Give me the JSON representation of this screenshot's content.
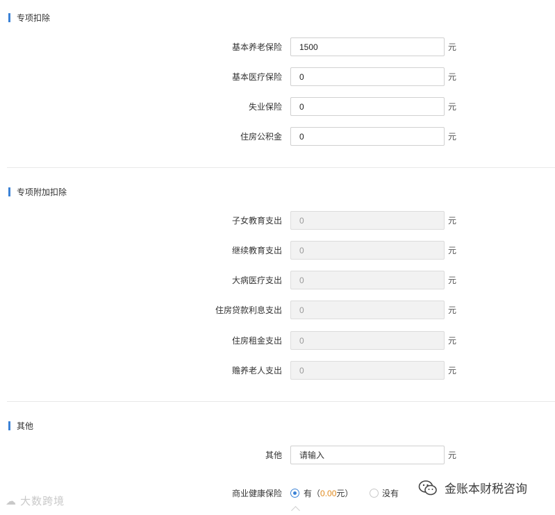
{
  "sections": {
    "special": {
      "title": "专项扣除",
      "rows": [
        {
          "label": "基本养老保险",
          "value": "1500",
          "unit": "元"
        },
        {
          "label": "基本医疗保险",
          "value": "0",
          "unit": "元"
        },
        {
          "label": "失业保险",
          "value": "0",
          "unit": "元"
        },
        {
          "label": "住房公积金",
          "value": "0",
          "unit": "元"
        }
      ]
    },
    "additional": {
      "title": "专项附加扣除",
      "rows": [
        {
          "label": "子女教育支出",
          "value": "0",
          "unit": "元"
        },
        {
          "label": "继续教育支出",
          "value": "0",
          "unit": "元"
        },
        {
          "label": "大病医疗支出",
          "value": "0",
          "unit": "元"
        },
        {
          "label": "住房贷款利息支出",
          "value": "0",
          "unit": "元"
        },
        {
          "label": "住房租金支出",
          "value": "0",
          "unit": "元"
        },
        {
          "label": "赡养老人支出",
          "value": "0",
          "unit": "元"
        }
      ]
    },
    "other": {
      "title": "其他",
      "other_label": "其他",
      "other_placeholder": "请输入",
      "other_unit": "元",
      "insurance_label": "商业健康保险",
      "option_yes": "有",
      "amount_open": "（",
      "amount_value": "0.00",
      "amount_close": "元）",
      "option_no": "没有",
      "selected": "yes"
    }
  },
  "watermarks": {
    "left": "大数跨境",
    "right": "金账本财税咨询"
  },
  "colors": {
    "accent": "#3b82d6",
    "amount": "#e08a1e"
  }
}
